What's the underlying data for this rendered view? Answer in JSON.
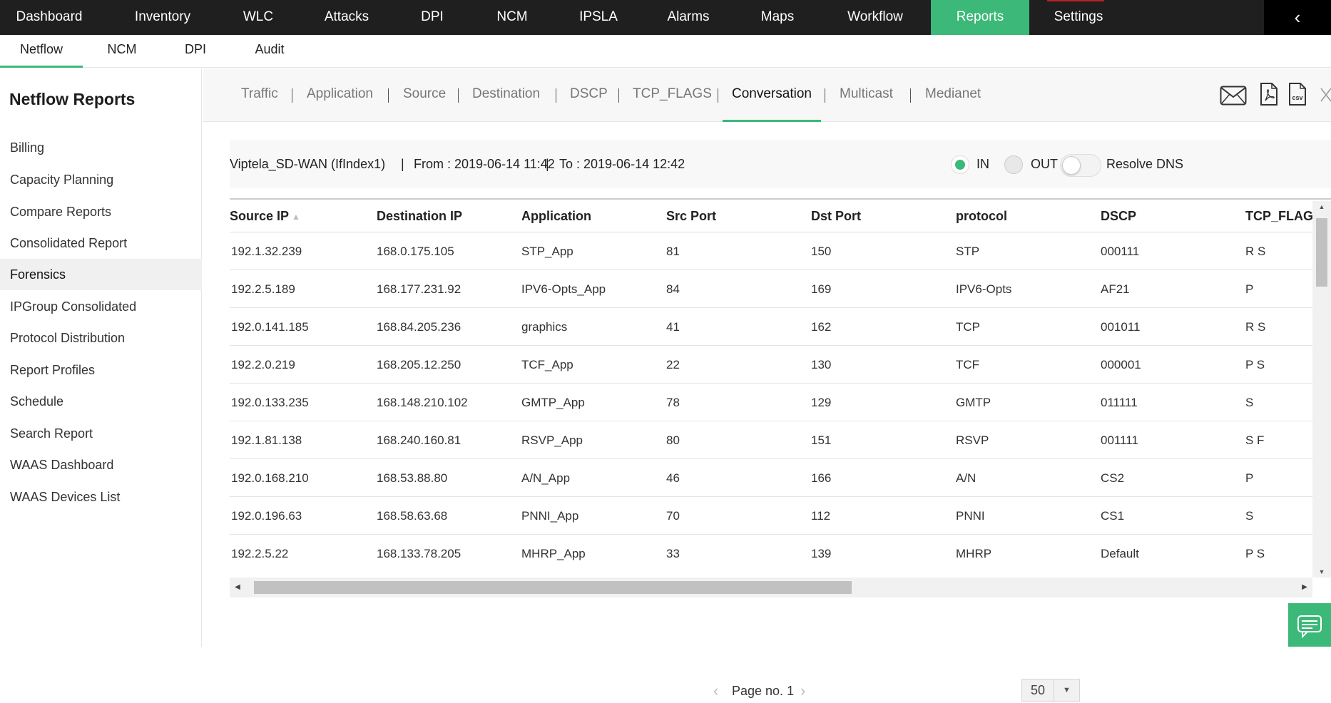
{
  "topnav": {
    "items": [
      "Dashboard",
      "Inventory",
      "WLC",
      "Attacks",
      "DPI",
      "NCM",
      "IPSLA",
      "Alarms",
      "Maps",
      "Workflow",
      "Reports",
      "Settings"
    ],
    "active": "Reports"
  },
  "subnav": {
    "items": [
      "Netflow",
      "NCM",
      "DPI",
      "Audit"
    ],
    "active": "Netflow"
  },
  "sidebar": {
    "title": "Netflow Reports",
    "items": [
      "Billing",
      "Capacity Planning",
      "Compare Reports",
      "Consolidated Report",
      "Forensics",
      "IPGroup Consolidated",
      "Protocol Distribution",
      "Report Profiles",
      "Schedule",
      "Search Report",
      "WAAS Dashboard",
      "WAAS Devices List"
    ],
    "active": "Forensics"
  },
  "report_tabs": {
    "items": [
      "Traffic",
      "Application",
      "Source",
      "Destination",
      "DSCP",
      "TCP_FLAGS",
      "Conversation",
      "Multicast",
      "Medianet"
    ],
    "active": "Conversation",
    "icons": [
      "mail-icon",
      "pdf-icon",
      "csv-icon",
      "close-icon"
    ],
    "csv_label": "csv"
  },
  "info": {
    "device": "Viptela_SD-WAN (IfIndex1)",
    "from": "From : 2019-06-14 11:42",
    "to": "To : 2019-06-14 12:42",
    "separator": "|",
    "in_label": "IN",
    "out_label": "OUT",
    "resolve_dns_label": "Resolve DNS",
    "direction_selected": "IN",
    "resolve_dns_on": false
  },
  "table": {
    "columns": [
      "Source IP",
      "Destination IP",
      "Application",
      "Src Port",
      "Dst Port",
      "protocol",
      "DSCP",
      "TCP_FLAGS"
    ],
    "rows": [
      [
        "192.1.32.239",
        "168.0.175.105",
        "STP_App",
        "81",
        "150",
        "STP",
        "000111",
        "R S"
      ],
      [
        "192.2.5.189",
        "168.177.231.92",
        "IPV6-Opts_App",
        "84",
        "169",
        "IPV6-Opts",
        "AF21",
        "P"
      ],
      [
        "192.0.141.185",
        "168.84.205.236",
        "graphics",
        "41",
        "162",
        "TCP",
        "001011",
        "R S"
      ],
      [
        "192.2.0.219",
        "168.205.12.250",
        "TCF_App",
        "22",
        "130",
        "TCF",
        "000001",
        "P S"
      ],
      [
        "192.0.133.235",
        "168.148.210.102",
        "GMTP_App",
        "78",
        "129",
        "GMTP",
        "011111",
        "S"
      ],
      [
        "192.1.81.138",
        "168.240.160.81",
        "RSVP_App",
        "80",
        "151",
        "RSVP",
        "001111",
        "S F"
      ],
      [
        "192.0.168.210",
        "168.53.88.80",
        "A/N_App",
        "46",
        "166",
        "A/N",
        "CS2",
        "P"
      ],
      [
        "192.0.196.63",
        "168.58.63.68",
        "PNNI_App",
        "70",
        "112",
        "PNNI",
        "CS1",
        "S"
      ],
      [
        "192.2.5.22",
        "168.133.78.205",
        "MHRP_App",
        "33",
        "139",
        "MHRP",
        "Default",
        "P S"
      ]
    ]
  },
  "pagination": {
    "label": "Page no. 1",
    "page_size": "50"
  },
  "colors": {
    "accent": "#3cb878",
    "topnav_bg": "#1f1f1f"
  }
}
